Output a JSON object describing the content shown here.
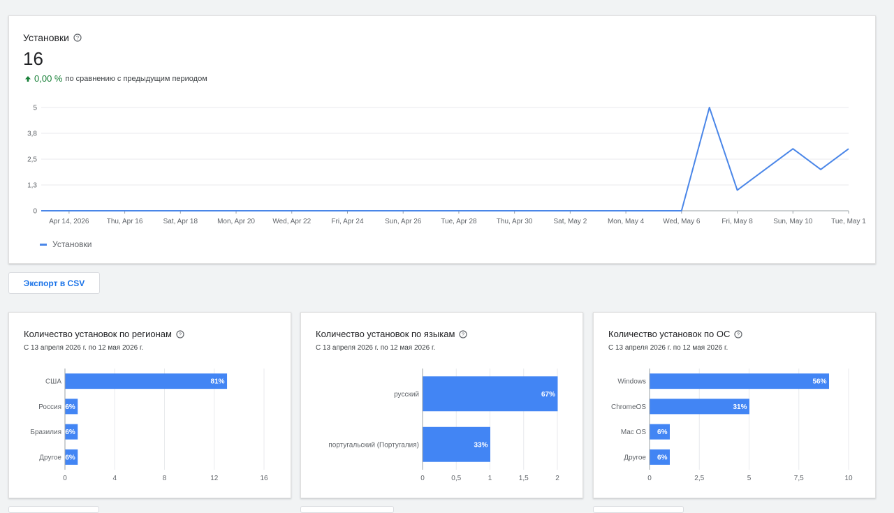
{
  "main": {
    "title": "Установки",
    "value": "16",
    "delta": "0,00 %",
    "delta_caption": "по сравнению с предыдущим периодом",
    "legend": "Установки",
    "chart_data": {
      "type": "line",
      "title": "Установки",
      "y_ticks": [
        "5",
        "3,8",
        "2,5",
        "1,3",
        "0"
      ],
      "y_tick_values": [
        5,
        3.75,
        2.5,
        1.25,
        0
      ],
      "ylim": [
        0,
        5
      ],
      "x_tick_labels": [
        "Apr 14, 2026",
        "Thu, Apr 16",
        "Sat, Apr 18",
        "Mon, Apr 20",
        "Wed, Apr 22",
        "Fri, Apr 24",
        "Sun, Apr 26",
        "Tue, Apr 28",
        "Thu, Apr 30",
        "Sat, May 2",
        "Mon, May 4",
        "Wed, May 6",
        "Fri, May 8",
        "Sun, May 10",
        "Tue, May 1"
      ],
      "x": [
        "2026-04-13",
        "2026-04-14",
        "2026-04-15",
        "2026-04-16",
        "2026-04-17",
        "2026-04-18",
        "2026-04-19",
        "2026-04-20",
        "2026-04-21",
        "2026-04-22",
        "2026-04-23",
        "2026-04-24",
        "2026-04-25",
        "2026-04-26",
        "2026-04-27",
        "2026-04-28",
        "2026-04-29",
        "2026-04-30",
        "2026-05-01",
        "2026-05-02",
        "2026-05-03",
        "2026-05-04",
        "2026-05-05",
        "2026-05-06",
        "2026-05-07",
        "2026-05-08",
        "2026-05-09",
        "2026-05-10",
        "2026-05-11",
        "2026-05-12"
      ],
      "series": [
        {
          "name": "Установки",
          "values": [
            0,
            0,
            0,
            0,
            0,
            0,
            0,
            0,
            0,
            0,
            0,
            0,
            0,
            0,
            0,
            0,
            0,
            0,
            0,
            0,
            0,
            0,
            0,
            0,
            5,
            1,
            2,
            3,
            2,
            3
          ]
        }
      ],
      "color": "#4a86e8",
      "grid": true,
      "legend_position": "bottom-left"
    }
  },
  "export_label": "Экспорт в CSV",
  "cards": [
    {
      "title": "Количество установок по регионам",
      "subtitle": "С 13 апреля 2026 г. по 12 мая 2026 г.",
      "chart_data": {
        "type": "bar",
        "orientation": "horizontal",
        "categories": [
          "США",
          "Россия",
          "Бразилия",
          "Другое"
        ],
        "values": [
          13,
          1,
          1,
          1
        ],
        "data_labels": [
          "81%",
          "6%",
          "6%",
          "6%"
        ],
        "x_ticks": [
          "0",
          "4",
          "8",
          "12",
          "16"
        ],
        "x_tick_values": [
          0,
          4,
          8,
          12,
          16
        ],
        "xlim": [
          0,
          16
        ],
        "color": "#4285f4"
      }
    },
    {
      "title": "Количество установок по языкам",
      "subtitle": "С 13 апреля 2026 г. по 12 мая 2026 г.",
      "chart_data": {
        "type": "bar",
        "orientation": "horizontal",
        "categories": [
          "русский",
          "португальский (Португалия)"
        ],
        "values": [
          2,
          1
        ],
        "data_labels": [
          "67%",
          "33%"
        ],
        "x_ticks": [
          "0",
          "0,5",
          "1",
          "1,5",
          "2"
        ],
        "x_tick_values": [
          0,
          0.5,
          1,
          1.5,
          2
        ],
        "xlim": [
          0,
          2
        ],
        "color": "#4285f4"
      }
    },
    {
      "title": "Количество установок по ОС",
      "subtitle": "С 13 апреля 2026 г. по 12 мая 2026 г.",
      "chart_data": {
        "type": "bar",
        "orientation": "horizontal",
        "categories": [
          "Windows",
          "ChromeOS",
          "Mac OS",
          "Другое"
        ],
        "values": [
          9,
          5,
          1,
          1
        ],
        "data_labels": [
          "56%",
          "31%",
          "6%",
          "6%"
        ],
        "x_ticks": [
          "0",
          "2,5",
          "5",
          "7,5",
          "10"
        ],
        "x_tick_values": [
          0,
          2.5,
          5,
          7.5,
          10
        ],
        "xlim": [
          0,
          10
        ],
        "color": "#4285f4"
      }
    }
  ]
}
